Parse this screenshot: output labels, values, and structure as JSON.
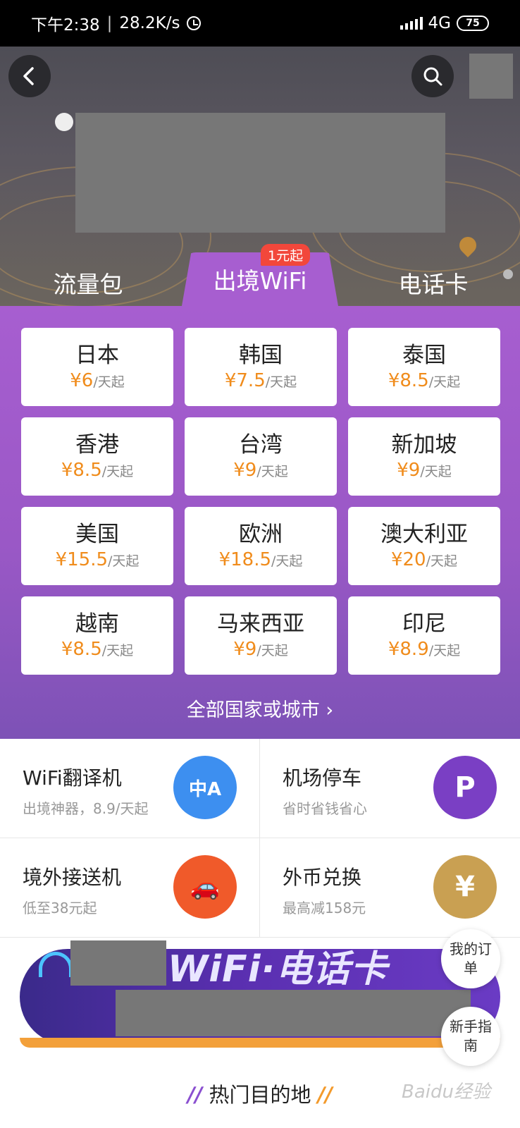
{
  "status_bar": {
    "time": "下午2:38",
    "network_speed": "28.2K/s",
    "separator": "|",
    "network_type": "4G",
    "battery": "75"
  },
  "tabs": [
    {
      "label": "流量包"
    },
    {
      "label": "出境WiFi",
      "badge": "1元起",
      "active": true
    },
    {
      "label": "电话卡"
    }
  ],
  "destinations": [
    {
      "name": "日本",
      "price": "¥6",
      "unit": "/天起"
    },
    {
      "name": "韩国",
      "price": "¥7.5",
      "unit": "/天起"
    },
    {
      "name": "泰国",
      "price": "¥8.5",
      "unit": "/天起"
    },
    {
      "name": "香港",
      "price": "¥8.5",
      "unit": "/天起"
    },
    {
      "name": "台湾",
      "price": "¥9",
      "unit": "/天起"
    },
    {
      "name": "新加坡",
      "price": "¥9",
      "unit": "/天起"
    },
    {
      "name": "美国",
      "price": "¥15.5",
      "unit": "/天起"
    },
    {
      "name": "欧洲",
      "price": "¥18.5",
      "unit": "/天起"
    },
    {
      "name": "澳大利亚",
      "price": "¥20",
      "unit": "/天起"
    },
    {
      "name": "越南",
      "price": "¥8.5",
      "unit": "/天起"
    },
    {
      "name": "马来西亚",
      "price": "¥9",
      "unit": "/天起"
    },
    {
      "name": "印尼",
      "price": "¥8.9",
      "unit": "/天起"
    }
  ],
  "all_link": "全部国家或城市 ›",
  "services": [
    {
      "title": "WiFi翻译机",
      "subtitle": "出境神器，8.9/天起",
      "icon": "translator-icon",
      "icon_text": "中A",
      "color": "#3d8ff0"
    },
    {
      "title": "机场停车",
      "subtitle": "省时省钱省心",
      "icon": "parking-icon",
      "icon_text": "P",
      "color": "#7a3fc4"
    },
    {
      "title": "境外接送机",
      "subtitle": "低至38元起",
      "icon": "car-plane-icon",
      "icon_text": "🚗",
      "color": "#f05a2a"
    },
    {
      "title": "外币兑换",
      "subtitle": "最高减158元",
      "icon": "currency-exchange-icon",
      "icon_text": "¥",
      "color": "#c9a052"
    }
  ],
  "banner": {
    "title": "WiFi·电话卡"
  },
  "float_buttons": {
    "orders": "我的订单",
    "guide": "新手指南"
  },
  "hot_destinations": {
    "title": "热门目的地",
    "deco_left": "//",
    "deco_right": "//"
  },
  "watermark": "Baidu经验"
}
